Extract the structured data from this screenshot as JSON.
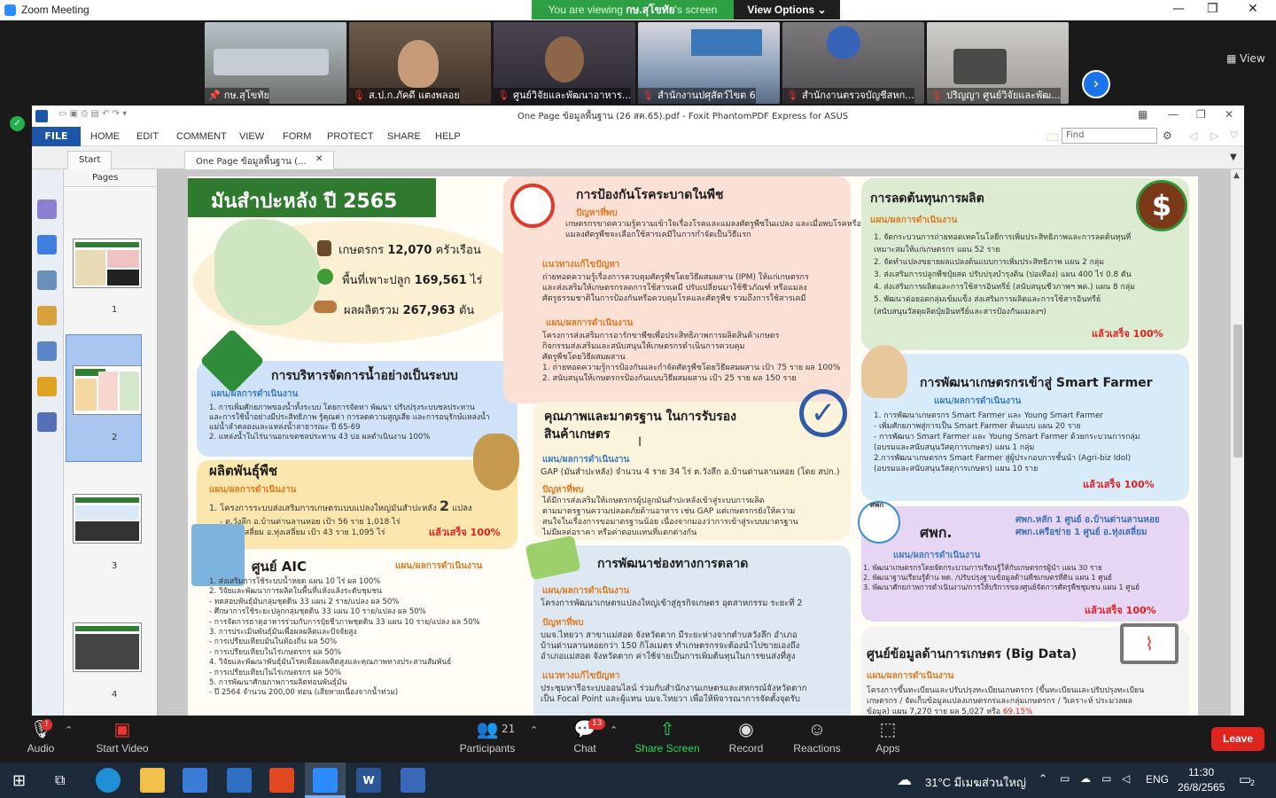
{
  "window": {
    "title": "Zoom Meeting",
    "minimize": "—",
    "maximize": "❐",
    "close": "✕"
  },
  "banner": {
    "viewing_prefix": "You are viewing ",
    "viewing_name": "กษ.สุโขทัย",
    "viewing_suffix": "'s screen",
    "view_options": "View Options ⌄"
  },
  "gallery": {
    "participants": [
      {
        "name": "กษ.สุโขทัย",
        "mic": "📌",
        "bg": "#8a8f86"
      },
      {
        "name": "ส.ป.ก.ภัคดี แตงพลอย",
        "mic": "🎙",
        "bg": "#5b4a3a"
      },
      {
        "name": "ศูนย์วิจัยและพัฒนาอาหาร...",
        "mic": "🎙",
        "bg": "#3d3a3e"
      },
      {
        "name": "สำนักงานปศุสัตว์ไขต 6",
        "mic": "🎙",
        "bg": "#7b8aa0"
      },
      {
        "name": "สำนักงานตรวจบัญชีสหก...",
        "mic": "🎙",
        "bg": "#6c6a6e"
      },
      {
        "name": "ปริญญา ศูนย์วิจัยและพัฒ...",
        "mic": "🎙",
        "bg": "#9c9a98"
      }
    ],
    "next": "›",
    "view_label": "▦ View"
  },
  "app": {
    "title": "One Page ข้อมูลพื้นฐาน (26 สค.65).pdf - Foxit PhantomPDF Express for ASUS",
    "file": "FILE",
    "menus": [
      "HOME",
      "EDIT",
      "COMMENT",
      "VIEW",
      "FORM",
      "PROTECT",
      "SHARE",
      "HELP"
    ],
    "find_placeholder": "Find",
    "tabs": [
      "Start",
      "One Page ข้อมูลพื้นฐาน (...",
      "✕"
    ],
    "pages_label": "Pages",
    "page_numbers": [
      "1",
      "2",
      "3",
      "4"
    ]
  },
  "infographic": {
    "title": "มันสำปะหลัง ปี 2565",
    "stats": [
      {
        "label": "เกษตรกร",
        "value": "12,070",
        "unit": "ครัวเรือน"
      },
      {
        "label": "พื้นที่เพาะปลูก",
        "value": "169,561",
        "unit": "ไร่"
      },
      {
        "label": "ผลผลิตรวม",
        "value": "267,963",
        "unit": "ตัน"
      }
    ],
    "water": {
      "title": "การบริหารจัดการน้ำอย่างเป็นระบบ",
      "sub": "แผน/ผลการดำเนินงาน",
      "body": "1. การเพิ่มศักยภาพของน้ำทั้งระบบ โดยการจัดหา พัฒนา ปรับปรุงระบบชลประทาน\nและการใช้น้ำอย่างมีประสิทธิภาพ รู้คุณค่า การลดความสูญเสีย และการอนุรักษ์แหล่งน้ำ\nแม่น้ำลำคลองและแหล่งน้ำสาธารณะ ปี 65-69\n2. แหล่งน้ำในไร่นานอกเขตชลประทาน 43 บ่อ ผลดำเนินงาน 100%"
    },
    "seed": {
      "title": "ผลิตพันธุ์พืช",
      "sub": "แผน/ผลการดำเนินงาน",
      "body": "1. โครงการระบบส่งเสริมการเกษตรแบบแปลงใหญ่มันสำปะหลัง",
      "count": "2",
      "unit": "แปลง",
      "body2": "- ต.วังลึก อ.บ้านด่านลานหอย เป้า 56 ราย 1,018 ไร่\n- อ.ทุ่งเสลี่ยม อ.ทุ่งเสลี่ยม เป้า 43 ราย 1,095 ไร่",
      "done": "แล้วเสร็จ 100%"
    },
    "aic": {
      "title": "ศูนย์ AIC",
      "sub": "แผน/ผลการดำเนินงาน",
      "body": "1. ส่งเสริมการใช้ระบบน้ำหยด แผน 10 ไร่ ผล 100%\n2. วิจัยและพัฒนาการผลิตในพื้นที่แห้งแล้งระดับชุมชน\n- ทดสอบพันธุ์มันกลุ่มชุดดิน 33 แผน 2 ราย/แปลง ผล 50%\n- ศึกษาการใช้ระยะปลูกกลุ่มชุดดิน 33 แผน 10 ราย/แปลง ผล 50%\n- การจัดการธาตุอาหารร่วมกับการปุ๋ยชีวภาพชุดดิน 33 แผน 10 ราย/แปลง ผล 50%\n3. การประเมินพันธุ์มันเพื่อผลผลิตและปัจจัยสูง\n- การเปรียบเทียบมันในท้องถิ่น ผล 50%\n- การเปรียบเทียบในไร่เกษตรกร ผล 50%\n4. วิจัยและพัฒนาพันธุ์มันโรคเพื่อผลผลิตสูงและคุณภาพทางประสานสัมพันธ์\n- การเปรียบเทียบในไร่เกษตรกร ผล 50%\n5. การพัฒนาศักยภาพการผลิตท่อนพันธุ์มัน\n- ปี 2564 จำนวน 200,00 ท่อน (เสียหายเนื่องจากน้ำท่วม)"
    },
    "pest": {
      "title": "การป้องกันโรคระบาดในพืช",
      "sub1": "ปัญหาที่พบ",
      "body1": "เกษตรกรขาดความรู้ความเข้าใจเรื่องโรคและแมลงศัตรูพืชในแปลง และเมื่อพบโรคหรือ\nแมลงศัตรูพืชจะเลือกใช้สารเคมีในการกำจัดเป็นวิธีแรก",
      "sub2": "แนวทางแก้ไขปัญหา",
      "body2": "ถ่ายทอดความรู้เรื่องการควบคุมศัตรูพืชโดยวิธีผสมผสาน (IPM) ให้แก่เกษตรกร\nและส่งเสริมให้เกษตรกรลดการใช้สารเคมี ปรับเปลี่ยนมาใช้ชีวภัณฑ์ หรือแมลง\nศัตรูธรรมชาติในการป้องกันหรือควบคุมโรคและศัตรูพืช รวมถึงการใช้สารเคมี",
      "sub3": "แผน/ผลการดำเนินงาน",
      "body3": "โครงการส่งเสริมการอารักขาพืชเพื่อประสิทธิภาพการผลิตสินค้าเกษตร\nกิจกรรมส่งเสริมและสนับสนุนให้เกษตรกรดำเนินการควบคุม\nศัตรูพืชโดยวิธีผสมผสาน\n1. ถ่ายทอดความรู้การป้องกันและกำจัดศัตรูพืชโดยวิธีผสมผสาน เป้า 75 ราย ผล 100%\n2. สนับสนุนให้เกษตรกรป้องกันแบบวิธีผสมผสาน เป้า 25 ราย ผล 150 ราย"
    },
    "gap": {
      "title": "คุณภาพและมาตรฐาน ในการรับรอง",
      "title2": "สินค้าเกษตร",
      "sub1": "แผน/ผลการดำเนินงาน",
      "body1": "GAP (มันสำปะหลัง) จำนวน 4 ราย 34 ไร่ ต.วังลึก อ.บ้านด่านลานหอย (โดย สปก.)",
      "sub2": "ปัญหาที่พบ",
      "body2": "ได้มีการส่งเสริมให้เกษตรกรผู้ปลูกมันสำปะหลังเข้าสู่ระบบการผลิต\nตามมาตรฐานความปลอดภัยด้านอาหาร เช่น GAP แต่เกษตรกรยังให้ความ\nสนใจในเรื่องการขอมาตรฐานน้อย เนื่องจากมองว่าการเข้าสู่ระบบมาตรฐาน\nไม่มีผลต่อราคา หรือค่าตอบแทนที่แตกต่างกัน"
    },
    "market": {
      "title": "การพัฒนาช่องทางการตลาด",
      "sub1": "แผน/ผลการดำเนินงาน",
      "body1": "โครงการพัฒนาเกษตรแปลงใหญ่เข้าสู่ธุรกิจเกษตร อุตสาหกรรม ระยะที่ 2",
      "sub2": "ปัญหาที่พบ",
      "body2": "บมจ.ไทยวา สาขาแม่สอด จังหวัดตาก มีระยะห่างจากตำบลวังลึก อำเภอ\nบ้านด่านลานหอยกว่า 150 กิโลเมตร ทำเกษตรกรจะต้องนำไปขายเองถึง\nอำเภอแม่สอด จังหวัดตาก ค่าใช้จ่ายเป็นการเพิ่มต้นทุนในการขนส่งที่สูง",
      "sub3": "แนวทางแก้ไขปัญหา",
      "body3": "ประชุมหารือระบบออนไลน์ ร่วมกับสำนักงานเกษตรและสหกรณ์จังหวัดตาก\nเป็น Focal Point และผู้แทน บมจ.ไทยวา เพื่อให้พิจารณาการจัดตั้งจุดรับ"
    },
    "cost": {
      "title": "การลดต้นทุนการผลิต",
      "sub": "แผน/ผลการดำเนินงาน",
      "body": "1. จัดกระบวนการถ่ายทอดเทคโนโลยีการเพิ่มประสิทธิภาพและการลดต้นทุนที่\nเหมาะสมให้แก่เกษตรกร แผน 52 ราย\n2. จัดทำแปลงขยายผลแปลงต้นแบบการเพิ่มประสิทธิภาพ แผน 2 กลุ่ม\n3. ส่งเสริมการปลูกพืชปุ๋ยสด ปรับปรุงบำรุงดิน (ปอเทือง) แผน 400 ไร่ 0.8 ตัน\n4. ส่งเสริมการผลิตและการใช้สารอินทรีย์ (สนับสนุนชีวภาพฯ พด.) แผน 8 กลุ่ม\n5. พัฒนาต่อยอดกลุ่มเข้มแข็ง ส่งเสริมการผลิตและการใช้สารอินทรีย์\n(สนับสนุนวัสดุผลิตปุ๋ยอินทรีย์และสารป้องกันแมลงฯ)",
      "done": "แล้วเสร็จ 100%"
    },
    "smart": {
      "title": "การพัฒนาเกษตรกรเข้าสู่ Smart Farmer",
      "sub": "แผน/ผลการดำเนินงาน",
      "body": "1. การพัฒนาเกษตรกร Smart Farmer และ Young Smart Farmer\n- เพิ่มศักยภาพสู่การเป็น Smart Farmer ต้นแบบ แผน 20 ราย\n- การพัฒนา Smart Farmer และ Young Smart Farmer ด้วยกระบวนการกลุ่ม\n(อบรมและสนับสนุนวัสดุการเกษตร) แผน 1 กลุ่ม\n2.การพัฒนาเกษตรกร Smart Farmer สู่ผู้ประกอบการชั้นนำ (Agri-biz Idol)\n(อบรมและสนับสนุนวัสดุการเกษตร) แผน 10 ราย",
      "done": "แล้วเสร็จ 100%"
    },
    "sapk": {
      "title": "ศพก.",
      "sub": "แผน/ผลการดำเนินงาน",
      "logo_text": "ศพก",
      "side1": "ศพก.หลัก 1 ศูนย์ อ.บ้านด่านลานหอย",
      "side2": "ศพก.เครือข่าย 1 ศูนย์ อ.ทุ่งเสลี่ยม",
      "body": "1. พัฒนาเกษตรกรโดยจัดกระบวนการเรียนรู้ให้กับเกษตรกรผู้นำ แผน 30 ราย\n2. พัฒนาฐานเรียนรู้ด้าน พด. /ปรับปรุงฐานข้อมูลด้านพืชเกษตรที่ดิน แผน 1 ศูนย์\n3. พัฒนาศักยภาพการดำเนินงาน/การให้บริการของศูนย์จัดการศัตรูพืชชุมชน แผน 1 ศูนย์",
      "done": "แล้วเสร็จ 100%"
    },
    "bigdata": {
      "title": "ศูนย์ข้อมูลด้านการเกษตร (Big Data)",
      "sub": "แผน/ผลการดำเนินงาน",
      "body": "โครงการขึ้นทะเบียนและปรับปรุงทะเบียนเกษตรกร (ขึ้นทะเบียนและปรับปรุงทะเบียน\nเกษตรกร / จัดเก็บข้อมูลแปลงเกษตรกรและกลุ่มเกษตรกร / วิเคราะห์ ประมวลผล\nข้อมูล) แผน 7,270 ราย ผล 5,027 หรือ",
      "pct": "69.15%"
    }
  },
  "controls": {
    "audio": "Audio",
    "audio_badge": "!",
    "video": "Start Video",
    "participants": "Participants",
    "participants_count": "21",
    "chat": "Chat",
    "chat_badge": "13",
    "share": "Share Screen",
    "record": "Record",
    "reactions": "Reactions",
    "apps": "Apps",
    "leave": "Leave"
  },
  "taskbar": {
    "weather": "31°C มีเมฆส่วนใหญ่",
    "lang": "ENG",
    "time": "11:30",
    "date": "26/8/2565",
    "notif": "2"
  },
  "colors": {
    "zoom_blue": "#2d8cff",
    "share_green": "#23d959",
    "leave_red": "#e0251e",
    "banner_green": "#2ea043"
  }
}
